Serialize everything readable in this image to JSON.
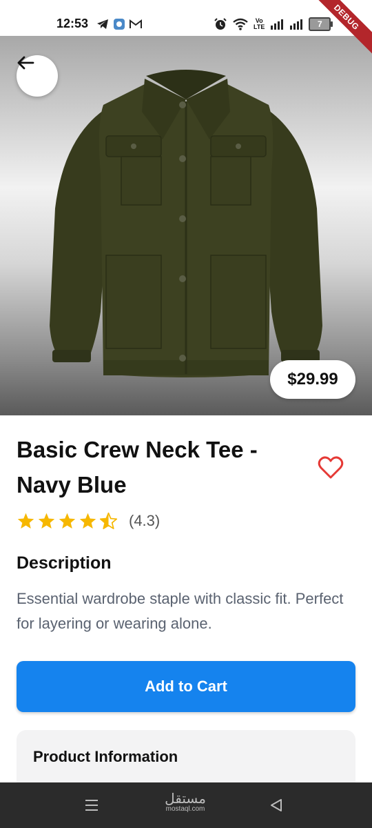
{
  "status_bar": {
    "time": "12:53",
    "network_label_top": "Vo",
    "network_label_bottom": "LTE",
    "battery": "7",
    "debug_label": "DEBUG"
  },
  "product": {
    "price": "$29.99",
    "title": "Basic Crew Neck Tee - Navy Blue",
    "rating": 4.3,
    "rating_text": "(4.3)",
    "description_heading": "Description",
    "description": "Essential wardrobe staple with classic fit. Perfect for layering or wearing alone."
  },
  "actions": {
    "add_to_cart_label": "Add to Cart"
  },
  "info_section": {
    "title": "Product Information"
  },
  "watermark": {
    "arabic": "مستقل",
    "latin": "mostaql.com"
  },
  "colors": {
    "primary_button": "#1583ee",
    "star": "#f6b700",
    "heart": "#e53935",
    "debug_ribbon": "#b3262b",
    "jacket": "#3d4121"
  },
  "icons": {
    "back": "arrow-left-icon",
    "favorite": "heart-outline-icon",
    "rating": "star-icon"
  }
}
